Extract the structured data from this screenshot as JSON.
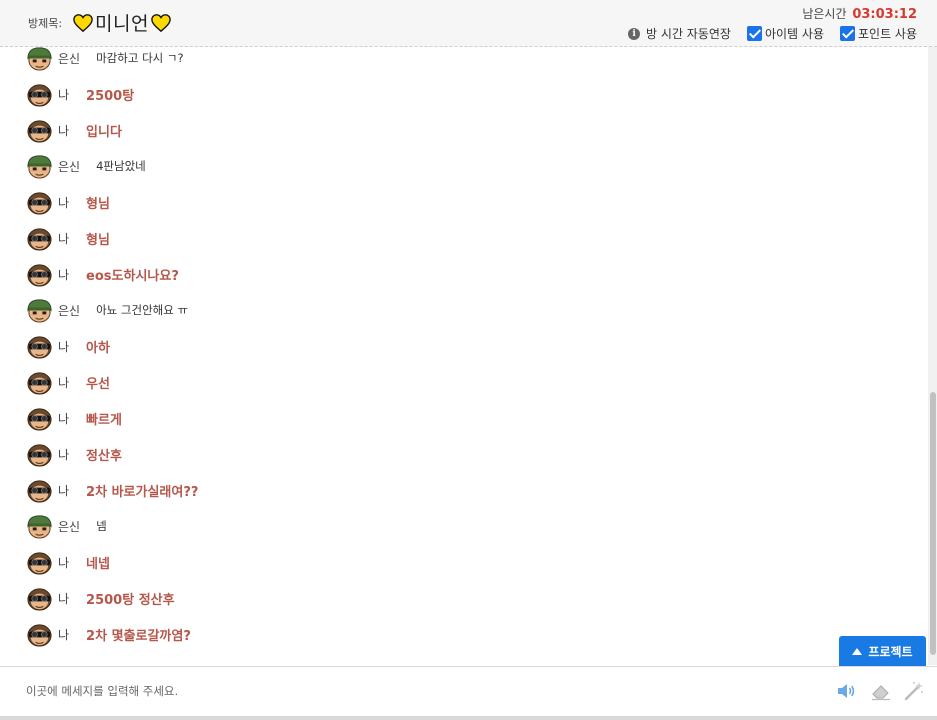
{
  "header": {
    "title_label": "방제목:",
    "room_title": "미니언",
    "remaining_label": "남은시간",
    "remaining_time": "03:03:12",
    "options": [
      {
        "label": "방 시간 자동연장",
        "type": "info",
        "icon": "info-icon"
      },
      {
        "label": "아이템 사용",
        "type": "checkbox",
        "checked": true
      },
      {
        "label": "포인트 사용",
        "type": "checkbox",
        "checked": true
      }
    ]
  },
  "chat": {
    "messages": [
      {
        "who": "other",
        "nick": "은신",
        "text": "마감하고 다시 ㄱ?"
      },
      {
        "who": "me",
        "nick": "나",
        "text": "2500탕"
      },
      {
        "who": "me",
        "nick": "나",
        "text": "입니다"
      },
      {
        "who": "other",
        "nick": "은신",
        "text": "4판남았네"
      },
      {
        "who": "me",
        "nick": "나",
        "text": "형님"
      },
      {
        "who": "me",
        "nick": "나",
        "text": "형님"
      },
      {
        "who": "me",
        "nick": "나",
        "text": "eos도하시나요?"
      },
      {
        "who": "other",
        "nick": "은신",
        "text": "아뇨 그건안해요 ㅠ"
      },
      {
        "who": "me",
        "nick": "나",
        "text": "아하"
      },
      {
        "who": "me",
        "nick": "나",
        "text": "우선"
      },
      {
        "who": "me",
        "nick": "나",
        "text": "빠르게"
      },
      {
        "who": "me",
        "nick": "나",
        "text": "정산후"
      },
      {
        "who": "me",
        "nick": "나",
        "text": "2차 바로가실래여??"
      },
      {
        "who": "other",
        "nick": "은신",
        "text": "넴"
      },
      {
        "who": "me",
        "nick": "나",
        "text": "네넵"
      },
      {
        "who": "me",
        "nick": "나",
        "text": "2500탕 정산후"
      },
      {
        "who": "me",
        "nick": "나",
        "text": "2차 몇출로갈까염?"
      }
    ]
  },
  "protect_button": {
    "label": "프로젝트",
    "icon": "triangle-up-icon"
  },
  "input": {
    "placeholder": "이곳에 메세지를 입력해 주세요.",
    "value": ""
  },
  "tools": [
    "speaker-icon",
    "eraser-icon",
    "magic-wand-icon"
  ],
  "colors": {
    "accent_blue": "#1a7ae3",
    "my_text": "#b5574b",
    "time_red": "#d63a2f",
    "heart_yellow": "#ffd800"
  }
}
